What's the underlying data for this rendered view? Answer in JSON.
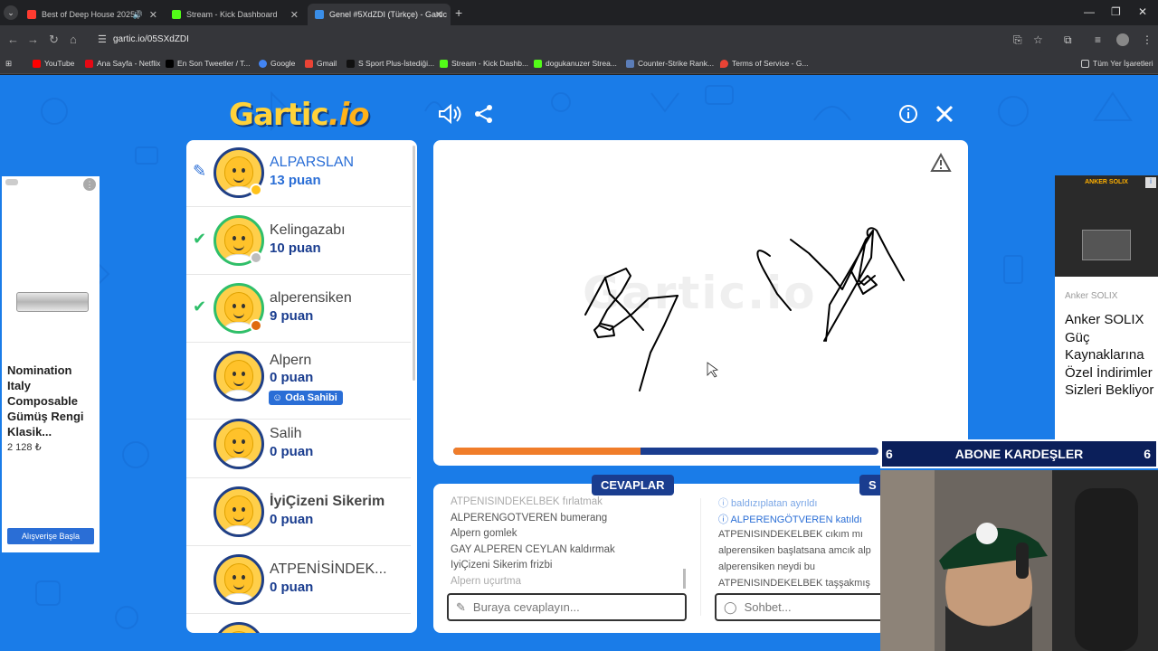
{
  "browser": {
    "tabs": [
      {
        "title": "Best of Deep House 2025 | ",
        "favicon_color": "#ff3b30"
      },
      {
        "title": "Stream - Kick Dashboard",
        "favicon_color": "#53fc18"
      },
      {
        "title": "Genel #5XdZDI (Türkçe) - Gartic",
        "favicon_color": "#3a8ee8"
      }
    ],
    "url": "gartic.io/05SXdZDI",
    "bookmarks": [
      {
        "label": "YouTube",
        "color": "#ff0000"
      },
      {
        "label": "Ana Sayfa - Netflix",
        "color": "#e50914"
      },
      {
        "label": "En Son Tweetler / T...",
        "color": "#000000"
      },
      {
        "label": "Google",
        "color": "#4285f4"
      },
      {
        "label": "Gmail",
        "color": "#ea4335"
      },
      {
        "label": "S Sport Plus-İstediği...",
        "color": "#111111"
      },
      {
        "label": "Stream - Kick Dashb...",
        "color": "#53fc18"
      },
      {
        "label": "dogukanuzer Strea...",
        "color": "#53fc18"
      },
      {
        "label": "Counter-Strike Rank...",
        "color": "#5b7db8"
      },
      {
        "label": "Terms of Service - G...",
        "color": "#ea4335"
      }
    ],
    "all_bookmarks": "Tüm Yer İşaretleri"
  },
  "game": {
    "logo_main": "Gartic",
    "logo_suffix": ".io",
    "players": [
      {
        "name": "ALPARSLAN",
        "score": "13 puan",
        "state": "drawing",
        "dot_color": "#ffc21a"
      },
      {
        "name": "Kelingazabı",
        "score": "10 puan",
        "state": "guessed",
        "dot_color": "#bdbdbd"
      },
      {
        "name": "alperensiken",
        "score": "9 puan",
        "state": "guessed",
        "dot_color": "#e06a10"
      },
      {
        "name": "Alpern",
        "score": "0 puan",
        "state": "host",
        "badge": "Oda Sahibi"
      },
      {
        "name": "Salih",
        "score": "0 puan",
        "state": "none"
      },
      {
        "name": "İyiÇizeni Sikerim",
        "score": "0 puan",
        "state": "none"
      },
      {
        "name": "ATPENİSİNDEK...",
        "score": "0 puan",
        "state": "none"
      }
    ],
    "canvas_watermark": "Gartic.io",
    "timer_fraction": 0.44,
    "answers_title": "CEVAPLAR",
    "chat_title_fragment": "S",
    "answers": [
      "ATPENISINDEKELBEK fırlatmak",
      "ALPERENGÖTVEREN bumerang",
      "Alpern gomlek",
      "GAY ALPEREN CEYLAN kaldırmak",
      "İyiÇizeni Sikerim frizbi",
      "Alpern uçurtma"
    ],
    "chat": [
      {
        "text": "ⓘ baldızıplatan ayrıldı",
        "type": "sys-first"
      },
      {
        "text": "ⓘ ALPERENGÖTVEREN katıldı",
        "type": "sys"
      },
      {
        "text": "ATPENISINDEKELBEK cıkım mı",
        "type": "msg"
      },
      {
        "text": "alperensiken başlatsana amcık alp",
        "type": "msg"
      },
      {
        "text": "alperensiken neydi bu",
        "type": "msg"
      },
      {
        "text": "ATPENISINDEKELBEK taşşakmış",
        "type": "msg"
      }
    ],
    "answer_placeholder": "Buraya cevaplayın...",
    "chat_placeholder": "Sohbet..."
  },
  "ads": {
    "left": {
      "title": "Nomination Italy Composable Gümüş Rengi Klasik...",
      "price": "2 128 ₺",
      "button": "Alışverişe Başla"
    },
    "right": {
      "headline_small": "ANKER SOLIX",
      "brand": "Anker SOLIX",
      "text": "Anker SOLIX Güç Kaynaklarına Özel İndirimler Sizleri Bekliyor"
    }
  },
  "overlay": {
    "left_num": "6",
    "text": "ABONE KARDEŞLER",
    "right_num": "6"
  }
}
